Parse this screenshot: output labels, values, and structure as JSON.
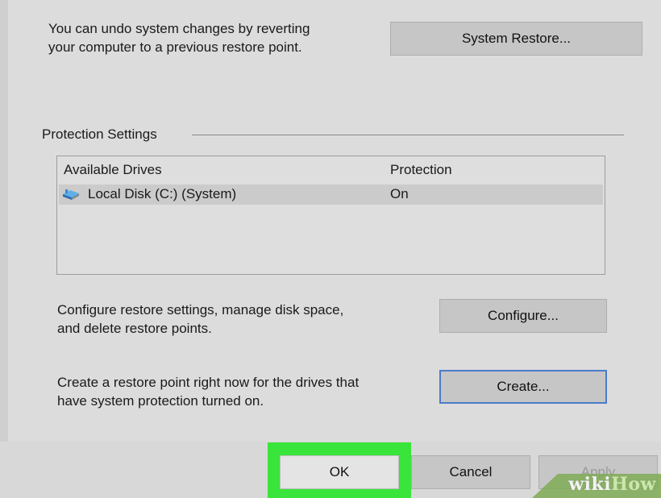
{
  "restore": {
    "description_line1": "You can undo system changes by reverting",
    "description_line2": "your computer to a previous restore point.",
    "system_restore_button": "System Restore..."
  },
  "protection": {
    "group_title": "Protection Settings",
    "table": {
      "columns": [
        "Available Drives",
        "Protection"
      ],
      "rows": [
        {
          "drive": "Local Disk (C:) (System)",
          "protection": "On",
          "icon": "drive-icon",
          "selected": true
        }
      ]
    },
    "configure": {
      "description_line1": "Configure restore settings, manage disk space,",
      "description_line2": "and delete restore points.",
      "button": "Configure..."
    },
    "create": {
      "description_line1": "Create a restore point right now for the drives that",
      "description_line2": "have system protection turned on.",
      "button": "Create..."
    }
  },
  "footer": {
    "ok": "OK",
    "cancel": "Cancel",
    "apply": "Apply"
  },
  "watermark": {
    "part1": "wiki",
    "part2": "How"
  },
  "colors": {
    "highlight": "#39e53a",
    "focus_border": "#4a7cc9"
  }
}
